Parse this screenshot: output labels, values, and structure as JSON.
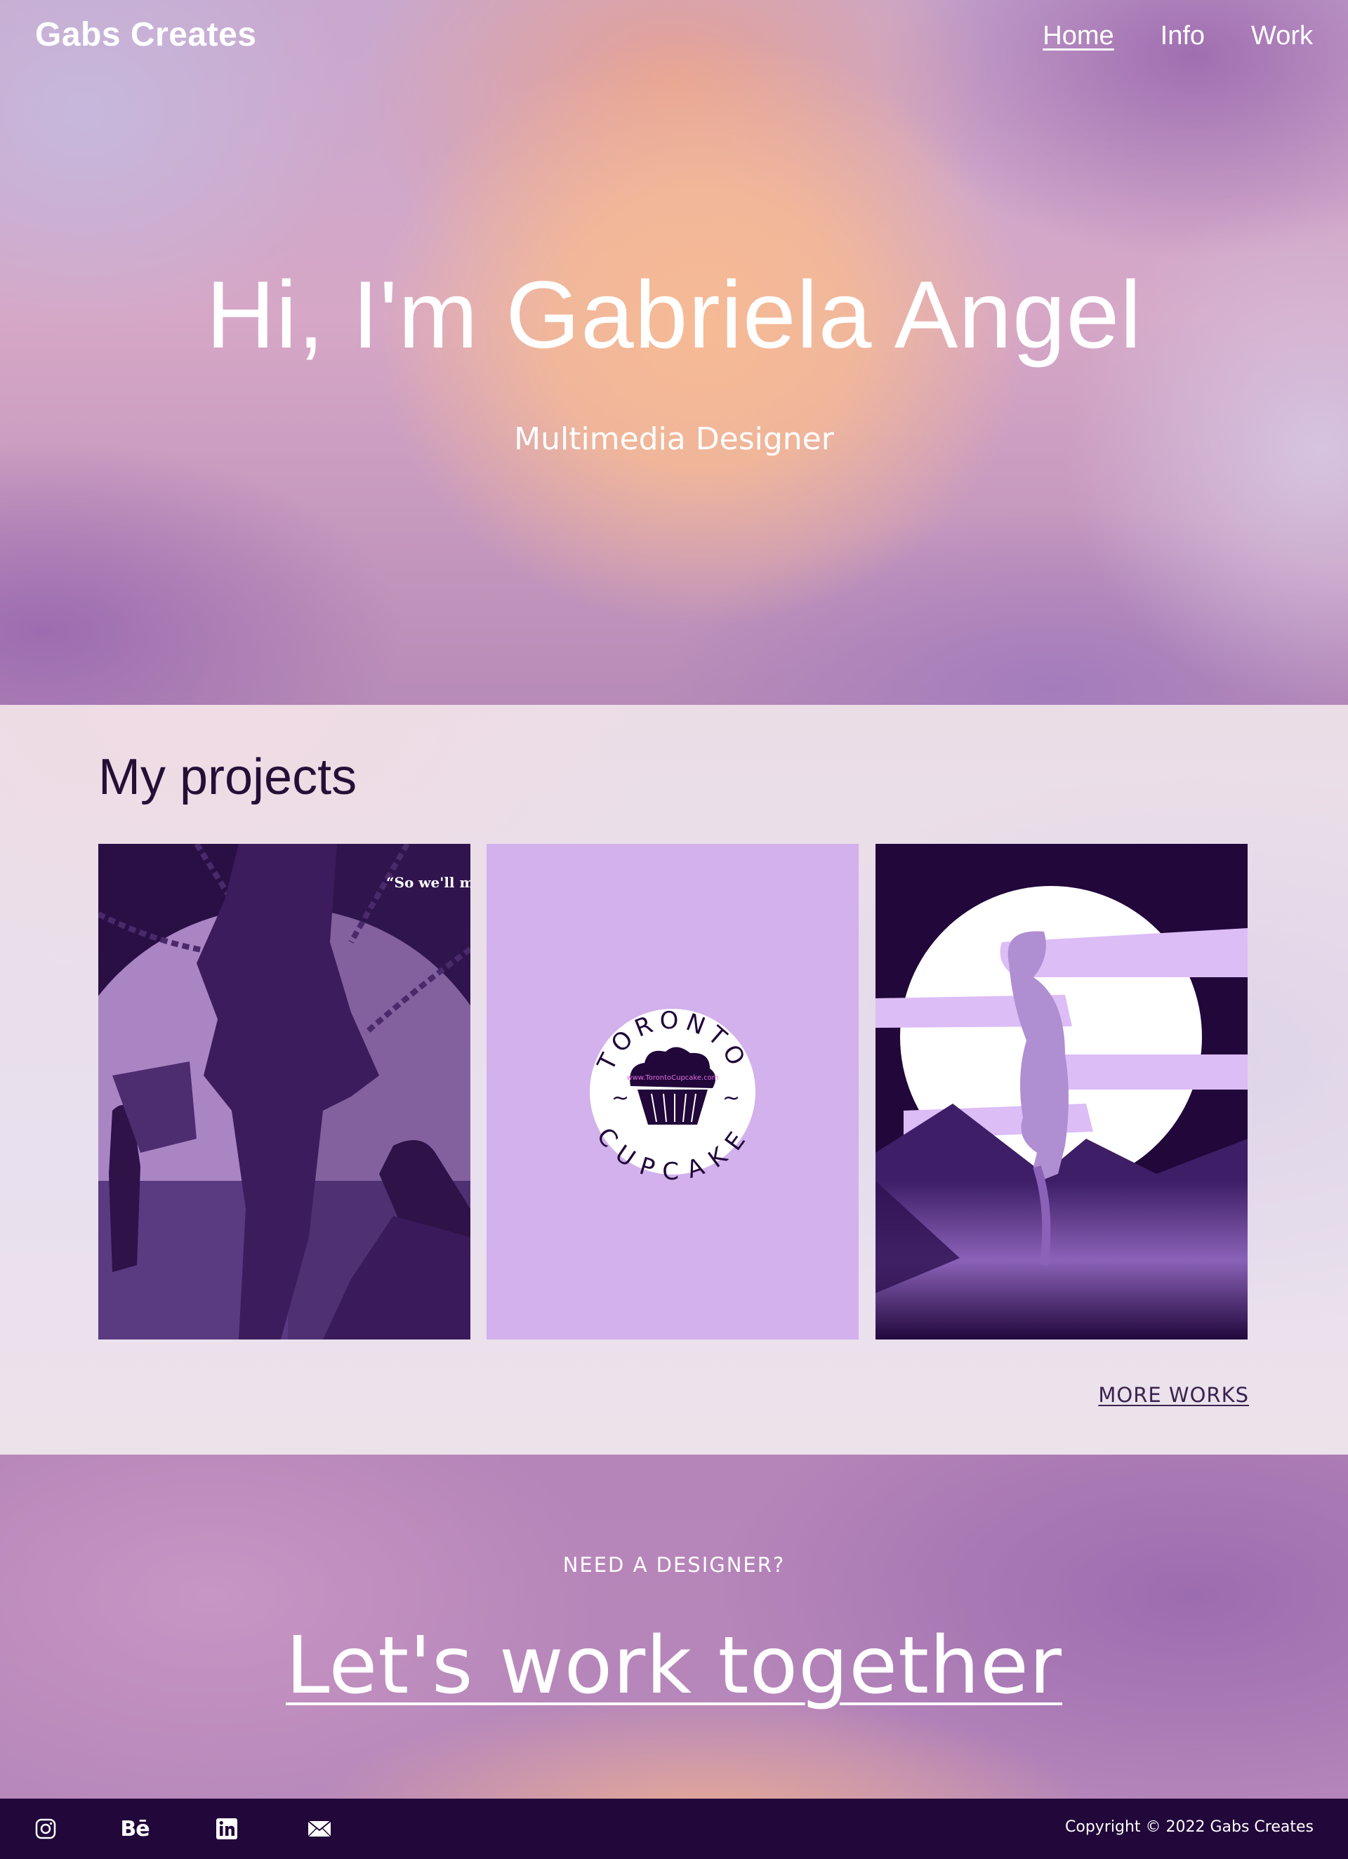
{
  "header": {
    "brand": "Gabs Creates",
    "nav": [
      {
        "label": "Home",
        "active": true
      },
      {
        "label": "Info",
        "active": false
      },
      {
        "label": "Work",
        "active": false
      }
    ]
  },
  "hero": {
    "title": "Hi, I'm Gabriela Angel",
    "subtitle": "Multimedia Designer"
  },
  "projects": {
    "title": "My projects",
    "cards": [
      {
        "icon": "silhouette-poster-artwork",
        "quote": "“So we'll m"
      },
      {
        "icon": "toronto-cupcake-logo",
        "logo_top": "TORONTO",
        "logo_bottom": "CUPCAKE",
        "logo_url": "www.TorontoCupcake.com"
      },
      {
        "icon": "fox-moon-artwork"
      }
    ],
    "more_label": "MORE WORKS"
  },
  "cta": {
    "kicker": "NEED A DESIGNER?",
    "link_label": "Let's work together"
  },
  "footer": {
    "social": [
      "instagram-icon",
      "behance-icon",
      "linkedin-icon",
      "email-icon"
    ],
    "behance_text": "Bē",
    "copyright": "Copyright © 2022 Gabs Creates"
  },
  "colors": {
    "dark_purple": "#21073a",
    "heading_purple": "#241037",
    "card_lilac": "#d2b1ec",
    "hero_peach": "#f6ba94"
  }
}
